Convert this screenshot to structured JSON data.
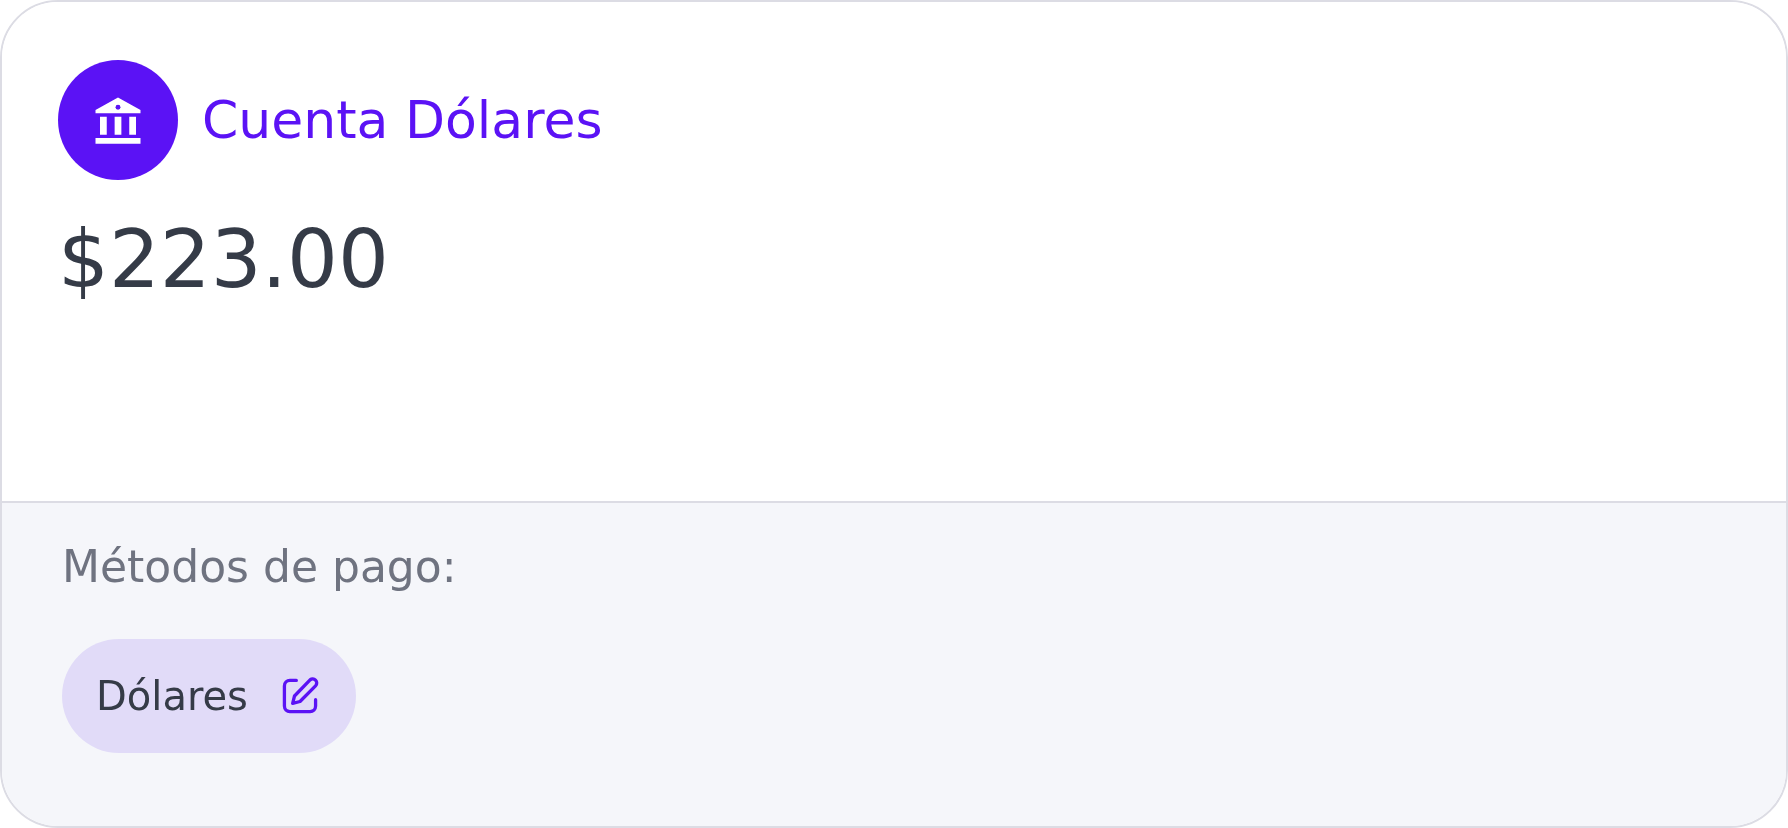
{
  "account": {
    "title": "Cuenta Dólares",
    "balance": "$223.00"
  },
  "payment_methods": {
    "label": "Métodos de pago:",
    "items": [
      {
        "label": "Dólares"
      }
    ]
  }
}
